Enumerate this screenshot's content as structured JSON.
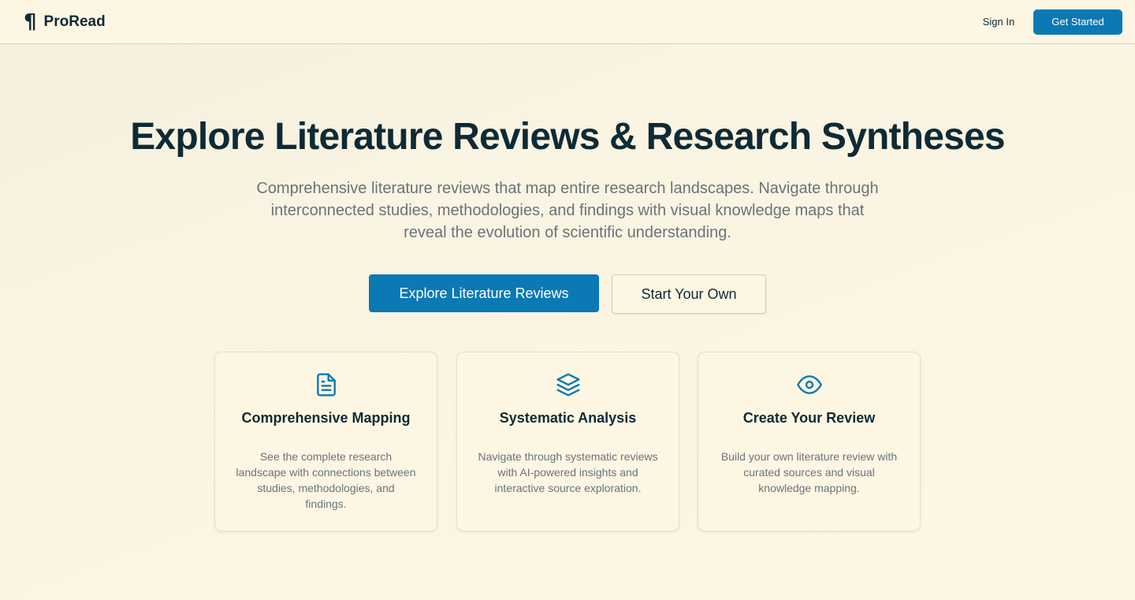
{
  "nav": {
    "brand_icon": "¶",
    "brand_name": "ProRead",
    "signin_label": "Sign In",
    "cta_label": "Get Started"
  },
  "hero": {
    "title": "Explore Literature Reviews & Research Syntheses",
    "subtitle": "Comprehensive literature reviews that map entire research landscapes. Navigate through interconnected studies, methodologies, and findings with visual knowledge maps that reveal the evolution of scientific understanding.",
    "primary_label": "Explore Literature Reviews",
    "secondary_label": "Start Your Own"
  },
  "features": [
    {
      "icon": "document-icon",
      "title": "Comprehensive Mapping",
      "description": "See the complete research landscape with connections between studies, methodologies, and findings."
    },
    {
      "icon": "layers-icon",
      "title": "Systematic Analysis",
      "description": "Navigate through systematic reviews with AI-powered insights and interactive source exploration."
    },
    {
      "icon": "eye-icon",
      "title": "Create Your Review",
      "description": "Build your own literature review with curated sources and visual knowledge mapping."
    }
  ],
  "colors": {
    "accent": "#0b79b4",
    "background": "#fdf6e3",
    "heading": "#0e2a36",
    "muted": "#6a737a"
  }
}
